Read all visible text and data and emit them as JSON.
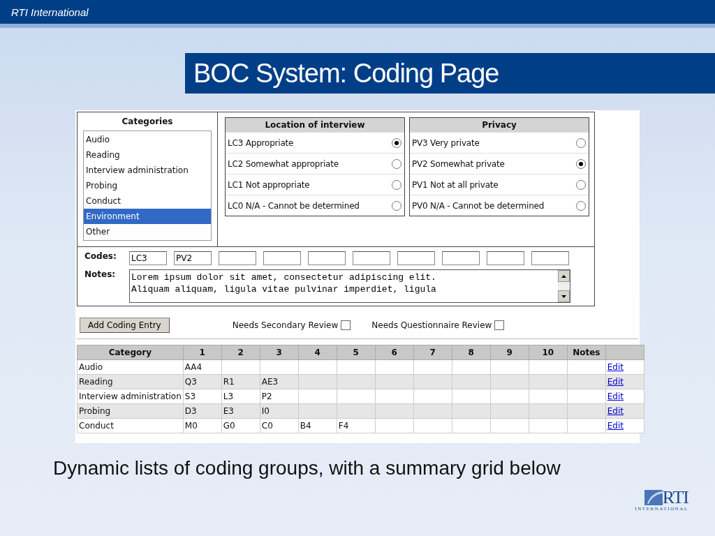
{
  "header": {
    "brand": "RTI International"
  },
  "slide_title": "BOC System: Coding Page",
  "form": {
    "categories": {
      "title": "Categories",
      "items": [
        {
          "label": "Audio",
          "selected": false
        },
        {
          "label": "Reading",
          "selected": false
        },
        {
          "label": "Interview administration",
          "selected": false
        },
        {
          "label": "Probing",
          "selected": false
        },
        {
          "label": "Conduct",
          "selected": false
        },
        {
          "label": "Environment",
          "selected": true
        },
        {
          "label": "Other",
          "selected": false
        }
      ]
    },
    "groups": [
      {
        "title": "Location of interview",
        "options": [
          {
            "label": "LC3 Appropriate",
            "selected": true
          },
          {
            "label": "LC2 Somewhat appropriate",
            "selected": false
          },
          {
            "label": "LC1 Not appropriate",
            "selected": false
          },
          {
            "label": "LC0 N/A - Cannot be determined",
            "selected": false
          }
        ]
      },
      {
        "title": "Privacy",
        "options": [
          {
            "label": "PV3 Very private",
            "selected": false
          },
          {
            "label": "PV2 Somewhat private",
            "selected": true
          },
          {
            "label": "PV1 Not at all private",
            "selected": false
          },
          {
            "label": "PV0 N/A - Cannot be determined",
            "selected": false
          }
        ]
      }
    ],
    "codes": {
      "label": "Codes:",
      "fields": [
        {
          "kind": "filled",
          "value": "LC3"
        },
        {
          "kind": "filled",
          "value": "PV2"
        },
        {
          "kind": "blank"
        },
        {
          "kind": "blank"
        },
        {
          "kind": "blank"
        },
        {
          "kind": "blank"
        },
        {
          "kind": "blank"
        },
        {
          "kind": "blank"
        },
        {
          "kind": "blank"
        },
        {
          "kind": "blank"
        }
      ]
    },
    "notes": {
      "label": "Notes:",
      "value": "Lorem ipsum dolor sit amet, consectetur adipiscing elit.\nAliquam aliquam, ligula vitae pulvinar imperdiet, ligula"
    },
    "add_button": "Add Coding Entry",
    "checkboxes": [
      {
        "label": "Needs Secondary Review",
        "checked": false
      },
      {
        "label": "Needs Questionnaire Review",
        "checked": false
      }
    ]
  },
  "grid": {
    "columns": [
      "Category",
      "1",
      "2",
      "3",
      "4",
      "5",
      "6",
      "7",
      "8",
      "9",
      "10",
      "Notes"
    ],
    "rows": [
      {
        "category": "Audio",
        "codes": [
          "AA4"
        ],
        "link": "Edit"
      },
      {
        "category": "Reading",
        "codes": [
          "Q3",
          "R1",
          "AE3"
        ],
        "link": "Edit"
      },
      {
        "category": "Interview administration",
        "codes": [
          "S3",
          "L3",
          "P2"
        ],
        "link": "Edit"
      },
      {
        "category": "Probing",
        "codes": [
          "D3",
          "E3",
          "I0"
        ],
        "link": "Edit"
      },
      {
        "category": "Conduct",
        "codes": [
          "M0",
          "G0",
          "C0",
          "B4",
          "F4"
        ],
        "link": "Edit"
      }
    ]
  },
  "caption": "Dynamic lists of coding groups, with a summary grid below",
  "logo": {
    "name": "RTI",
    "tagline": "INTERNATIONAL"
  }
}
